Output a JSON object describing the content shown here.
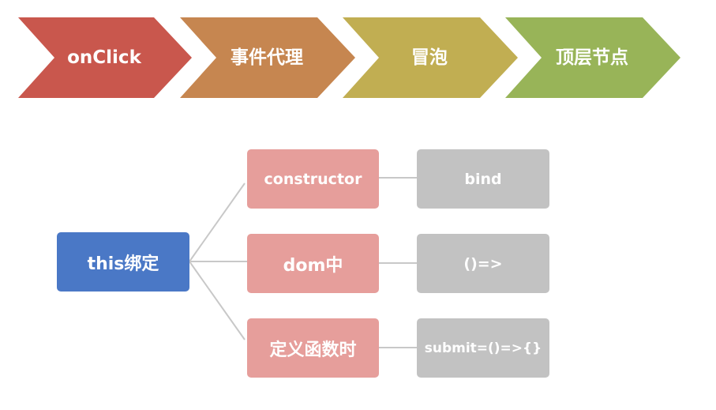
{
  "flow": {
    "steps": [
      {
        "label": "onClick",
        "color": "#c9574d"
      },
      {
        "label": "事件代理",
        "color": "#c68650"
      },
      {
        "label": "冒泡",
        "color": "#c1ae52"
      },
      {
        "label": "顶层节点",
        "color": "#98b458"
      }
    ]
  },
  "tree": {
    "root": {
      "label": "this绑定",
      "color": "#4a78c6"
    },
    "branches": [
      {
        "label": "constructor",
        "leaf": "bind"
      },
      {
        "label": "dom中",
        "leaf": "()=>"
      },
      {
        "label": "定义函数时",
        "leaf": "submit=()=>{}"
      }
    ],
    "branch_color": "#e69e9b",
    "leaf_color": "#c2c2c2",
    "connector_color": "#c8c8c8"
  }
}
